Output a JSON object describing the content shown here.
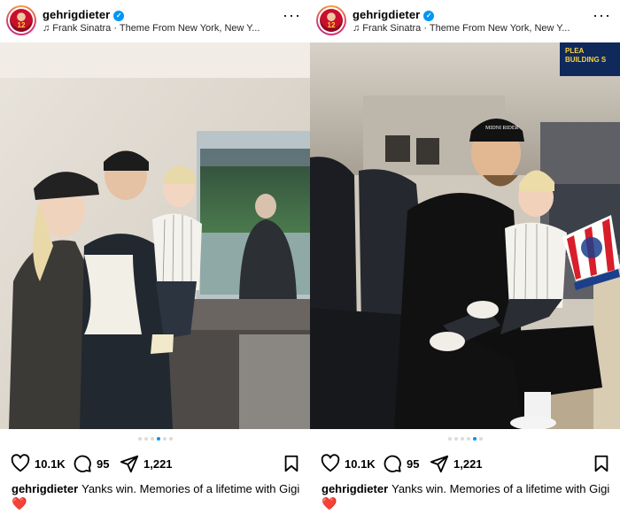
{
  "posts": [
    {
      "username": "gehrigdieter",
      "avatar_number": "12",
      "music": "Frank Sinatra · Theme From New York, New Y...",
      "likes": "10.1K",
      "comments": "95",
      "shares": "1,221",
      "caption_user": "gehrigdieter",
      "caption_text": "Yanks win. Memories of a lifetime with Gigi",
      "caption_emoji": "❤️",
      "carousel_dots": 6,
      "carousel_active": 3
    },
    {
      "username": "gehrigdieter",
      "avatar_number": "12",
      "music": "Frank Sinatra · Theme From New York, New Y...",
      "likes": "10.1K",
      "comments": "95",
      "shares": "1,221",
      "caption_user": "gehrigdieter",
      "caption_text": "Yanks win. Memories of a lifetime with Gigi",
      "caption_emoji": "❤️",
      "carousel_dots": 6,
      "carousel_active": 4
    }
  ],
  "right_photo": {
    "scoreboard_lines": [
      "PLEA",
      "BUILDING S"
    ],
    "cap_text": "MIDNI RIDER"
  },
  "icons": {
    "verified": "verified-badge-icon",
    "music": "music-note-icon",
    "more": "more-dots-icon",
    "like": "heart-icon",
    "comment": "comment-bubble-icon",
    "share": "paper-plane-icon",
    "save": "bookmark-icon"
  },
  "colors": {
    "verified_blue": "#0095f6",
    "active_dot": "#0095f6",
    "inactive_dot": "#dbdbdb",
    "heart_red": "#e0245e"
  }
}
